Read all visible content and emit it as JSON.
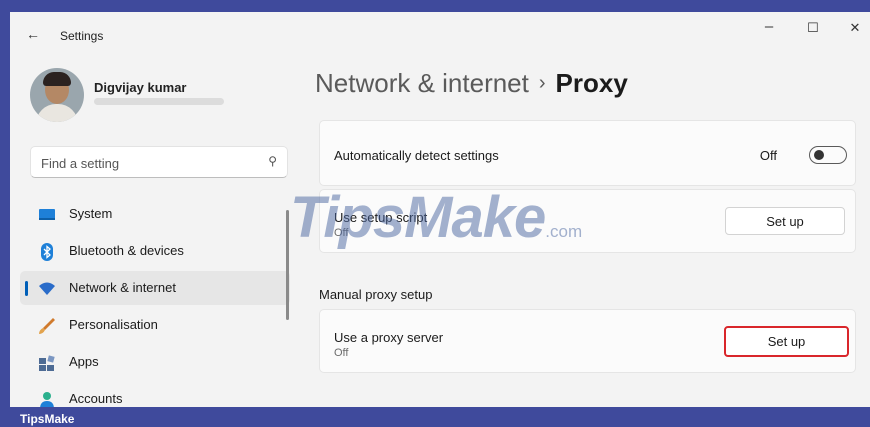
{
  "window": {
    "title": "Settings",
    "back_glyph": "←",
    "controls": {
      "minimize": "–",
      "maximize": "☐",
      "close": "✕"
    }
  },
  "user": {
    "name": "Digvijay kumar"
  },
  "search": {
    "placeholder": "Find a setting",
    "value": "",
    "icon": "⚲"
  },
  "sidebar": {
    "items": [
      {
        "label": "System",
        "icon": "system-icon",
        "color": "#1e80d8"
      },
      {
        "label": "Bluetooth & devices",
        "icon": "bluetooth-icon",
        "color": "#1e80d8"
      },
      {
        "label": "Network & internet",
        "icon": "wifi-icon",
        "color": "#2a6cc9",
        "active": true
      },
      {
        "label": "Personalisation",
        "icon": "brush-icon",
        "color": "#d07a2c"
      },
      {
        "label": "Apps",
        "icon": "apps-icon",
        "color": "#4d6b94"
      },
      {
        "label": "Accounts",
        "icon": "accounts-icon",
        "color": "#2bb08d"
      }
    ]
  },
  "breadcrumb": {
    "parent": "Network & internet",
    "separator": "›",
    "current": "Proxy"
  },
  "auto_detect": {
    "title": "Automatically detect settings",
    "state": "Off"
  },
  "setup_script": {
    "title": "Use setup script",
    "state": "Off",
    "button": "Set up"
  },
  "manual": {
    "heading": "Manual proxy setup",
    "title": "Use a proxy server",
    "state": "Off",
    "button": "Set up"
  },
  "watermark": {
    "text": "TipsMake",
    "suffix": ".com"
  },
  "footer": {
    "brand": "TipsMake"
  },
  "colors": {
    "accent": "#005fb8",
    "highlight": "#d9262b",
    "footer_bar": "#3f4a9c"
  }
}
